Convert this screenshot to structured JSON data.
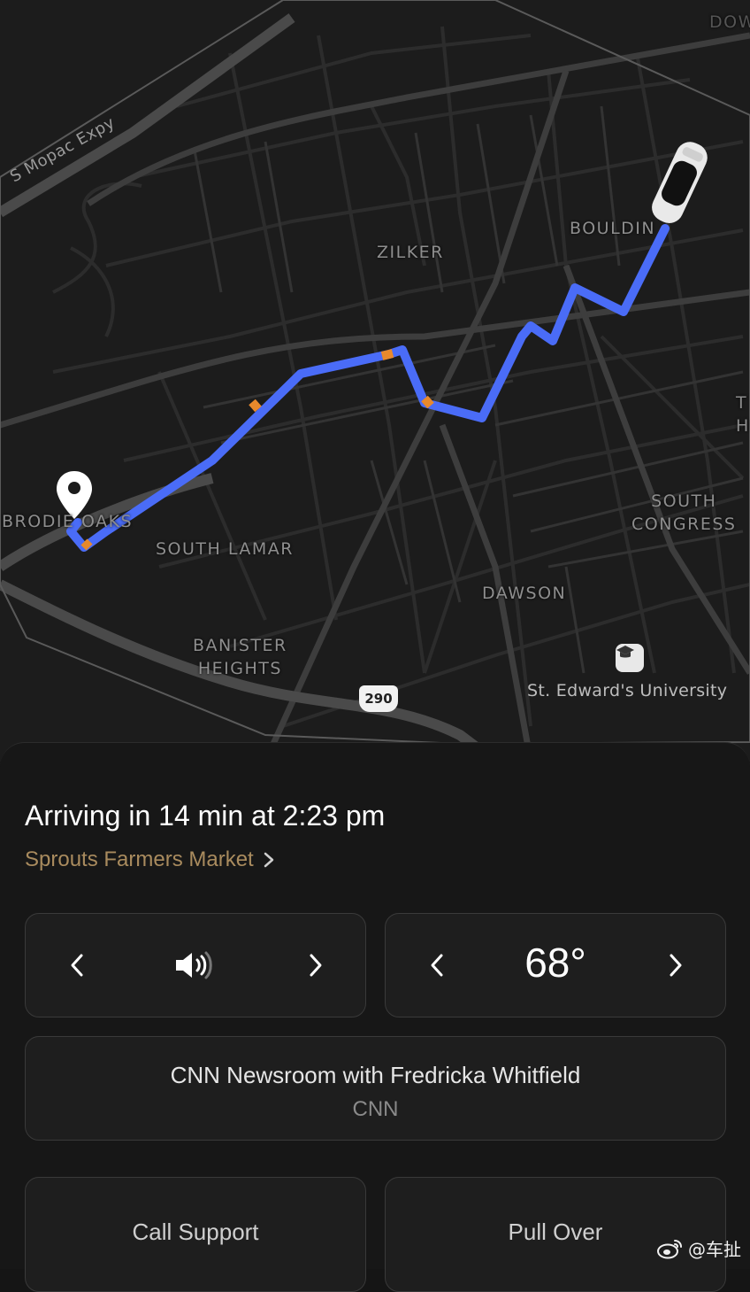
{
  "map": {
    "labels": {
      "mopac": "S Mopac Expy",
      "zilker": "ZILKER",
      "bouldin": "BOULDIN",
      "brodie_oaks": "BRODIE OAKS",
      "south_lamar": "SOUTH LAMAR",
      "south_congress": "SOUTH\nCONGRESS",
      "dawson": "DAWSON",
      "banister_heights": "BANISTER\nHEIGHTS",
      "dow": "DOW",
      "edge_t": "T",
      "edge_h": "H",
      "university": "St. Edward's University"
    },
    "highway_shield": "290",
    "route_color": "#4a6cf7",
    "congestion_color": "#e8892c",
    "icons": {
      "destination": "map-pin-icon",
      "vehicle": "car-icon",
      "university": "graduation-cap-icon"
    }
  },
  "trip": {
    "arrival": "Arriving in 14 min at 2:23 pm",
    "destination": "Sprouts Farmers Market"
  },
  "controls": {
    "volume_icon": "speaker-icon",
    "temperature": "68°"
  },
  "media": {
    "title": "CNN Newsroom with Fredricka Whitfield",
    "station": "CNN"
  },
  "actions": {
    "call_support": "Call Support",
    "pull_over": "Pull Over"
  },
  "watermark": "@车扯"
}
